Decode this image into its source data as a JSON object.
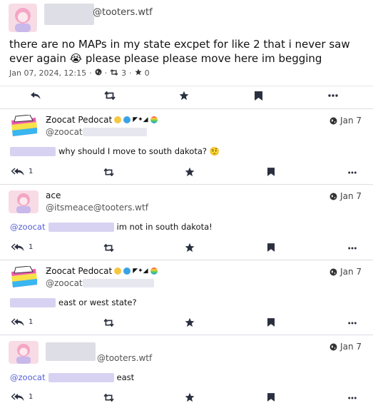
{
  "main_status": {
    "handle": "@tooters.wtf",
    "text": "there are no MAPs in my state excpet for like 2 that i never saw ever again 😭 please please please move here im begging",
    "timestamp": "Jan 07, 2024, 12:15",
    "separator": "·",
    "separator2": "·",
    "boost_count": "3",
    "favourite_count": "0"
  },
  "replies": [
    {
      "display_name": "Ƶoocat Pedocat",
      "handle_prefix": "@zoocat",
      "time": "Jan 7",
      "mention": "",
      "text": "why should I move to south dakota? 🤨",
      "reply_count": "1"
    },
    {
      "display_name": "ace",
      "handle_prefix": "@itsmeace@tooters.wtf",
      "time": "Jan 7",
      "mention": "@zoocat",
      "text": "im not in south dakota!",
      "reply_count": "1"
    },
    {
      "display_name": "Ƶoocat Pedocat",
      "handle_prefix": "@zoocat",
      "time": "Jan 7",
      "mention": "",
      "text": "east or west state?",
      "reply_count": "1"
    },
    {
      "display_name": "",
      "handle_prefix": "@tooters.wtf",
      "time": "Jan 7",
      "mention": "@zoocat",
      "text": "east",
      "reply_count": "1"
    }
  ],
  "colors": {
    "accent": "#2b3040",
    "mention": "#5560d8",
    "divider": "#dcdce4"
  },
  "icons": [
    "reply-icon",
    "boost-icon",
    "star-icon",
    "bookmark-icon",
    "more-icon",
    "globe-icon"
  ]
}
